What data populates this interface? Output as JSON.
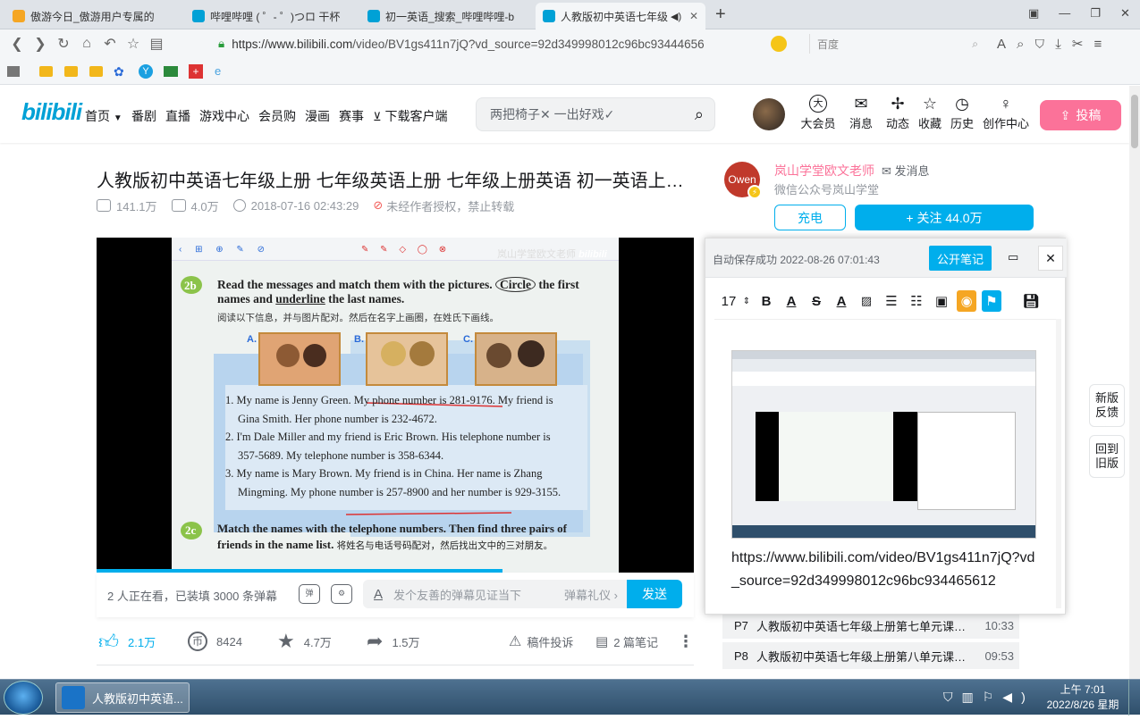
{
  "browser": {
    "tabs": [
      {
        "title": "傲游今日_傲游用户专属的",
        "color": "#f5a623"
      },
      {
        "title": "哔哩哔哩 ( ゜- ゜)つロ 干杯",
        "color": "#00a1d6"
      },
      {
        "title": "初一英语_搜索_哔哩哔哩-b",
        "color": "#00a1d6"
      },
      {
        "title": "人教版初中英语七年级",
        "color": "#00a1d6"
      }
    ],
    "url_host": "https://www.bilibili.com",
    "url_path": "/video/BV1gs411n7jQ?vd_source=92d349998012c96bc93444656",
    "search_engine": "百度"
  },
  "site": {
    "logo": "bilibili",
    "nav": [
      "首页",
      "番剧",
      "直播",
      "游戏中心",
      "会员购",
      "漫画",
      "赛事",
      "下载客户端"
    ],
    "search_placeholder": "两把椅子✕ 一出好戏✓",
    "header_icons": [
      {
        "icon": "vip-icon",
        "glyph": "大",
        "label": "大会员"
      },
      {
        "icon": "message-icon",
        "glyph": "✉",
        "label": "消息"
      },
      {
        "icon": "dynamic-icon",
        "glyph": "✢",
        "label": "动态"
      },
      {
        "icon": "star-icon",
        "glyph": "☆",
        "label": "收藏"
      },
      {
        "icon": "clock-icon",
        "glyph": "◷",
        "label": "历史"
      },
      {
        "icon": "bulb-icon",
        "glyph": "♀",
        "label": "创作中心"
      }
    ],
    "upload_label": "投稿",
    "accent": "#00aeec",
    "pink": "#fb7299"
  },
  "video": {
    "title": "人教版初中英语七年级上册 七年级英语上册 七年级上册英语 初一英语上…",
    "views": "141.1万",
    "danmaku_count": "4.0万",
    "date": "2018-07-16 02:43:29",
    "copyright": "未经作者授权，禁止转载",
    "watermark": "岚山学堂欧文老师",
    "textbook": {
      "badge1": "2b",
      "instruction1": "Read the messages and match them with the pictures.",
      "circle_word": "Circle",
      "instruction1b": "the first",
      "instruction2a": "names and",
      "underline_word": "underline",
      "instruction2b": "the last names.",
      "chinese1": "阅读以下信息，并与图片配对。然后在名字上画圈，在姓氏下画线。",
      "pic_labels": [
        "A.",
        "B.",
        "C."
      ],
      "lines": [
        "1.  My name is Jenny Green. My phone number is 281-9176. My friend is",
        "Gina Smith. Her phone number is 232-4672.",
        "2.  I'm Dale Miller and my friend is Eric Brown. His telephone number is",
        "357-5689. My telephone number is 358-6344.",
        "3.  My name is Mary Brown. My friend is in China. Her name is Zhang",
        "Mingming. My phone number is 257-8900 and her number is 929-3155."
      ],
      "badge2": "2c",
      "instruction3": "Match the names with the telephone numbers. Then find three pairs of",
      "instruction4": "friends in the name list.",
      "chinese2": "将姓名与电话号码配对，然后找出文中的三对朋友。"
    },
    "progress_fraction": 0.68,
    "viewers_text": "2 人正在看，已装填 3000 条弹幕",
    "danmaku_placeholder": "发个友善的弹幕见证当下",
    "danmaku_etiquette": "弹幕礼仪 ›",
    "send_label": "发送",
    "likes": "2.1万",
    "coins": "8424",
    "favorites": "4.7万",
    "shares": "1.5万",
    "report_label": "稿件投诉",
    "notes_label": "2 篇笔记"
  },
  "up": {
    "avatar_text": "Owen",
    "name": "岚山学堂欧文老师",
    "message_label": "发消息",
    "sign": "微信公众号岚山学堂",
    "charge_label": "充电",
    "follow_label": "+ 关注 44.0万"
  },
  "playlist": [
    {
      "p": "P7",
      "title": "人教版初中英语七年级上册第七单元课文…",
      "duration": "10:33"
    },
    {
      "p": "P8",
      "title": "人教版初中英语七年级上册第八单元课文…",
      "duration": "09:53"
    }
  ],
  "side_buttons": [
    {
      "line1": "新版",
      "line2": "反馈"
    },
    {
      "line1": "回到",
      "line2": "旧版"
    }
  ],
  "notes": {
    "autosave": "自动保存成功  2022-08-26 07:01:43",
    "publish_label": "公开笔记",
    "font_size": "17",
    "url_text": "https://www.bilibili.com/video/BV1gs411n7jQ?vd_source=92d349998012c96bc934465612"
  },
  "taskbar": {
    "app_label": "人教版初中英语...",
    "time": "上午 7:01",
    "date": "2022/8/26 星期五"
  }
}
